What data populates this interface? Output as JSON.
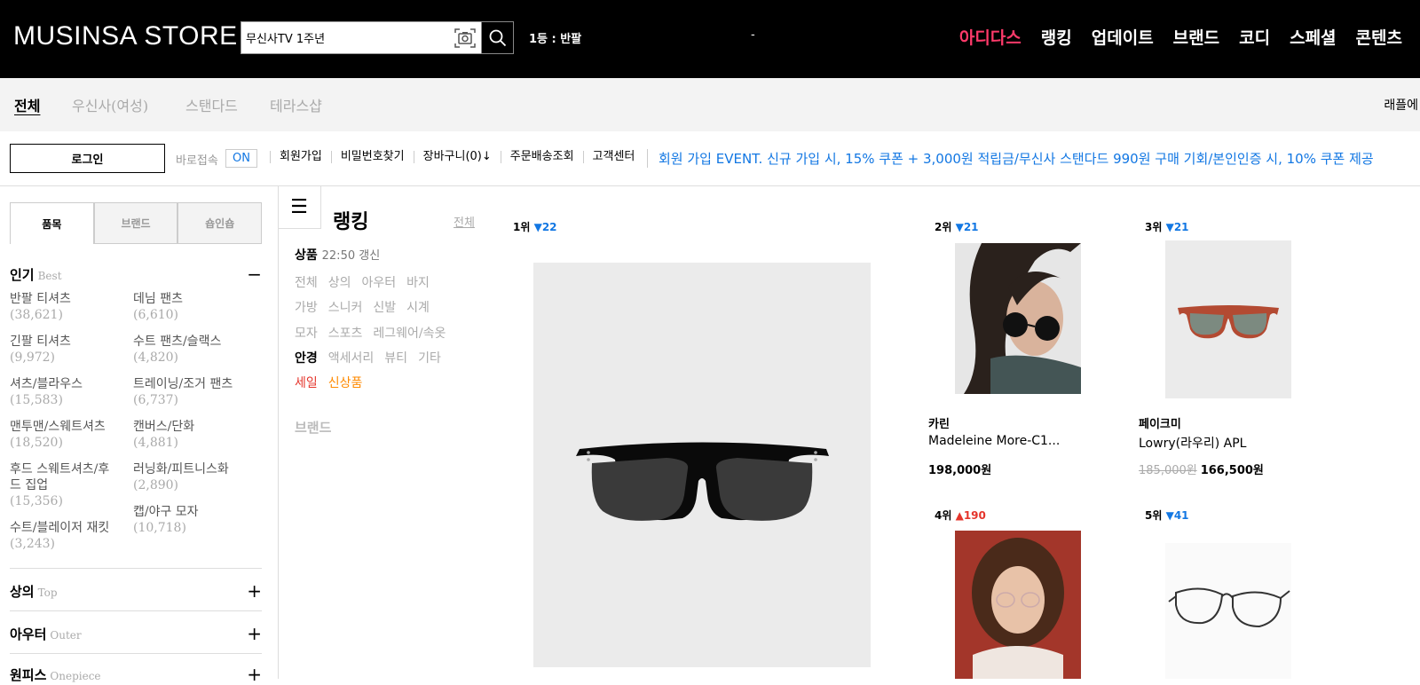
{
  "header": {
    "logo": "MUSINSA STORE",
    "search_value": "무신사TV 1주년",
    "trending": "1등 : 반팔",
    "trend_dash": "-",
    "nav": [
      "아디다스",
      "랭킹",
      "업데이트",
      "브랜드",
      "코디",
      "스페셜",
      "콘텐츠"
    ],
    "nav_highlight_color": "#ff3a6a"
  },
  "store_tabs": {
    "items": [
      "전체",
      "우신사(여성)",
      "스탠다드",
      "테라스샵"
    ],
    "active": "전체",
    "right_text": "래플에"
  },
  "util_bar": {
    "login_label": "로그인",
    "direct_label": "바로접속",
    "toggle_label": "ON",
    "links": [
      "회원가입",
      "비밀번호찾기",
      "장바구니(0)↓",
      "주문배송조회",
      "고객센터"
    ],
    "event_text": "회원 가입 EVENT. 신규 가입 시, 15% 쿠폰 + 3,000원 적립금/무신사 스탠다드 990원 구매 기회/본인인증 시, 10% 쿠폰 제공",
    "accent_color": "#1277e3"
  },
  "sidebar": {
    "tabs": [
      "품목",
      "브랜드",
      "숍인숍"
    ],
    "popular": {
      "title": "인기",
      "subtitle": "Best",
      "toggle": "−",
      "items": [
        {
          "name": "반팔 티셔츠",
          "count": "(38,621)"
        },
        {
          "name": "데님 팬츠",
          "count": "(6,610)"
        },
        {
          "name": "긴팔 티셔츠",
          "count": "(9,972)"
        },
        {
          "name": "수트 팬츠/슬랙스",
          "count": "(4,820)"
        },
        {
          "name": "셔츠/블라우스",
          "count": "(15,583)"
        },
        {
          "name": "트레이닝/조거 팬츠",
          "count": "(6,737)"
        },
        {
          "name": "맨투맨/스웨트셔츠",
          "count": "(18,520)"
        },
        {
          "name": "캔버스/단화",
          "count": "(4,881)"
        },
        {
          "name": "후드 스웨트셔츠/후드 집업",
          "count": "(15,356)"
        },
        {
          "name": "러닝화/피트니스화",
          "count": "(2,890)"
        },
        {
          "name": "수트/블레이저 재킷",
          "count": "(3,243)"
        },
        {
          "name": "캡/야구 모자",
          "count": "(10,718)"
        }
      ]
    },
    "categories": [
      {
        "title": "상의",
        "subtitle": "Top",
        "toggle": "+"
      },
      {
        "title": "아우터",
        "subtitle": "Outer",
        "toggle": "+"
      },
      {
        "title": "원피스",
        "subtitle": "Onepiece",
        "toggle": "+"
      }
    ]
  },
  "ranking_menu": {
    "title": "랭킹",
    "all_link": "전체",
    "product_label": "상품",
    "update_time": "22:50 갱신",
    "rows": [
      [
        "전체",
        "상의",
        "아우터",
        "바지"
      ],
      [
        "가방",
        "스니커",
        "신발",
        "시계"
      ],
      [
        "모자",
        "스포츠",
        "레그웨어/속옷"
      ],
      [
        "안경",
        "액세서리",
        "뷰티",
        "기타"
      ],
      [
        "세일",
        "신상품"
      ]
    ],
    "active": "안경",
    "brand_label": "브랜드"
  },
  "products": [
    {
      "rank": "1위",
      "change_icon": "▼",
      "change": "22",
      "direction": "down",
      "brand": "",
      "name": "",
      "price": ""
    },
    {
      "rank": "2위",
      "change_icon": "▼",
      "change": "21",
      "direction": "down",
      "brand": "카린",
      "name": "Madeleine More-C1...",
      "price": "198,000원",
      "old_price": ""
    },
    {
      "rank": "3위",
      "change_icon": "▼",
      "change": "21",
      "direction": "down",
      "brand": "페이크미",
      "name": "Lowry(라우리) APL",
      "price": "166,500원",
      "old_price": "185,000원"
    },
    {
      "rank": "4위",
      "change_icon": "▲",
      "change": "190",
      "direction": "up",
      "brand": "",
      "name": "",
      "price": ""
    },
    {
      "rank": "5위",
      "change_icon": "▼",
      "change": "41",
      "direction": "down",
      "brand": "",
      "name": "",
      "price": ""
    }
  ]
}
